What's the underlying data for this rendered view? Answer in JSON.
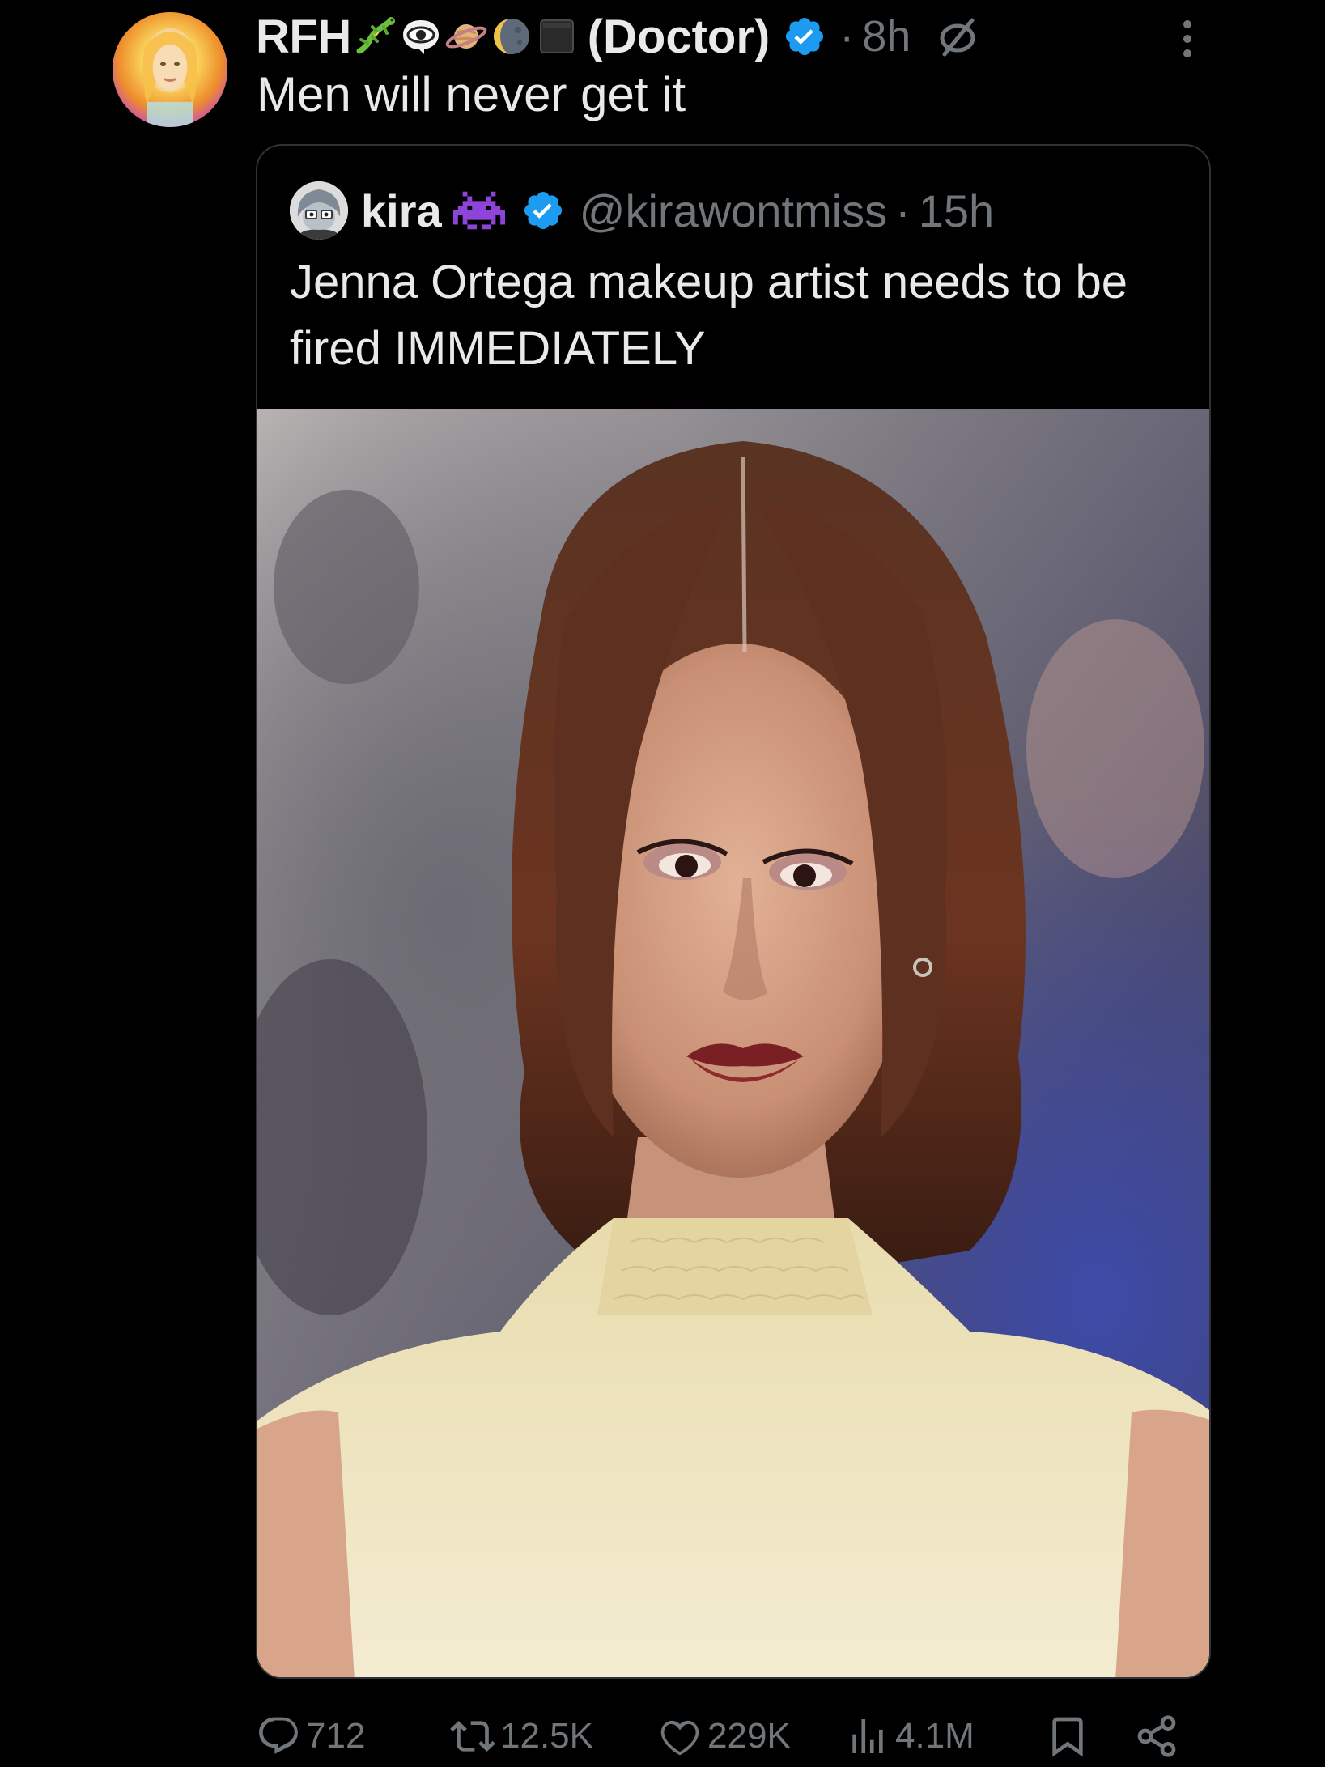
{
  "post": {
    "display_name": "RFH",
    "name_suffix": "(Doctor)",
    "separator": "·",
    "timestamp": "8h",
    "text": "Men will never get it",
    "icons": {
      "avatar": "profile-avatar",
      "emojis": [
        "lizard-emoji",
        "eye-in-speech-bubble-emoji",
        "ringed-planet-emoji",
        "moon-phase-emoji",
        "black-square-emoji"
      ],
      "verified": "verified-badge-icon",
      "extra": "null-set-icon",
      "more": "more-options-icon"
    }
  },
  "quote": {
    "name": "kira",
    "handle": "@kirawontmiss",
    "separator": "·",
    "timestamp": "15h",
    "text": "Jenna Ortega makeup artist needs to be fired IMMEDIATELY",
    "icons": {
      "avatar": "quote-avatar",
      "emoji": "space-invader-emoji",
      "verified": "verified-badge-icon"
    }
  },
  "actions": {
    "reply": "712",
    "retweet": "12.5K",
    "like": "229K",
    "views": "4.1M",
    "icons": [
      "reply-icon",
      "retweet-icon",
      "like-icon",
      "views-icon",
      "bookmark-icon",
      "share-icon"
    ]
  },
  "colors": {
    "background": "#000000",
    "primary_text": "#e7e9ea",
    "secondary_text": "#71767b",
    "verified_blue": "#1d9bf0",
    "border": "#2f3336"
  }
}
